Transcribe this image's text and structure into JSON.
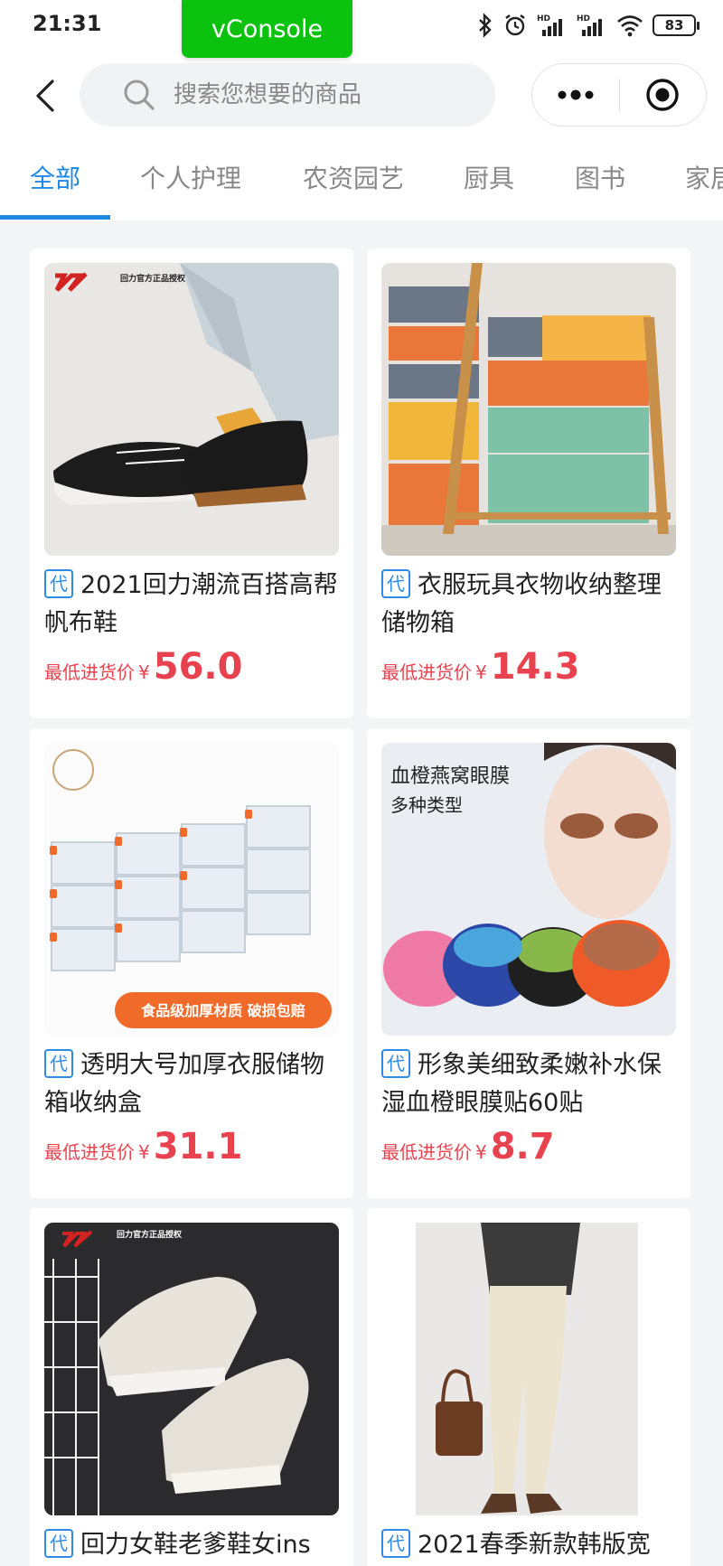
{
  "status": {
    "time": "21:31",
    "vconsole": "vConsole",
    "battery": "83",
    "signal1_label": "HD",
    "signal2_label": "HD"
  },
  "nav": {
    "search_placeholder": "搜索您想要的商品"
  },
  "tabs": [
    {
      "label": "全部",
      "active": true
    },
    {
      "label": "个人护理",
      "active": false
    },
    {
      "label": "农资园艺",
      "active": false
    },
    {
      "label": "厨具",
      "active": false
    },
    {
      "label": "图书",
      "active": false
    },
    {
      "label": "家居",
      "active": false
    }
  ],
  "price_label": "最低进货价",
  "currency": "¥",
  "tag_label": "代",
  "products": [
    {
      "title": "2021回力潮流百搭高帮帆布鞋",
      "price": "56.0",
      "image": "black-canvas-high-top-shoes",
      "image_text": "回力官方正品授权"
    },
    {
      "title": "衣服玩具衣物收纳整理储物箱",
      "price": "14.3",
      "image": "colorful-storage-boxes-on-shelf"
    },
    {
      "title": "透明大号加厚衣服储物箱收纳盒",
      "price": "31.1",
      "image": "clear-storage-boxes",
      "image_text": "食品级加厚材质  破损包赔"
    },
    {
      "title": "形象美细致柔嫩补水保湿血橙眼膜贴60贴",
      "price": "8.7",
      "image": "eye-mask-jars",
      "image_text": "血橙燕窝眼膜",
      "image_subtext": "多种类型"
    },
    {
      "title": "回力女鞋老爹鞋女ins",
      "price": "",
      "image": "white-chunky-sneakers",
      "image_text": "回力官方正品授权"
    },
    {
      "title": "2021春季新款韩版宽",
      "price": "",
      "image": "beige-pants-model"
    }
  ],
  "colors": {
    "accent": "#1e88e5",
    "price": "#e8424f",
    "vconsole": "#0bc30f"
  }
}
